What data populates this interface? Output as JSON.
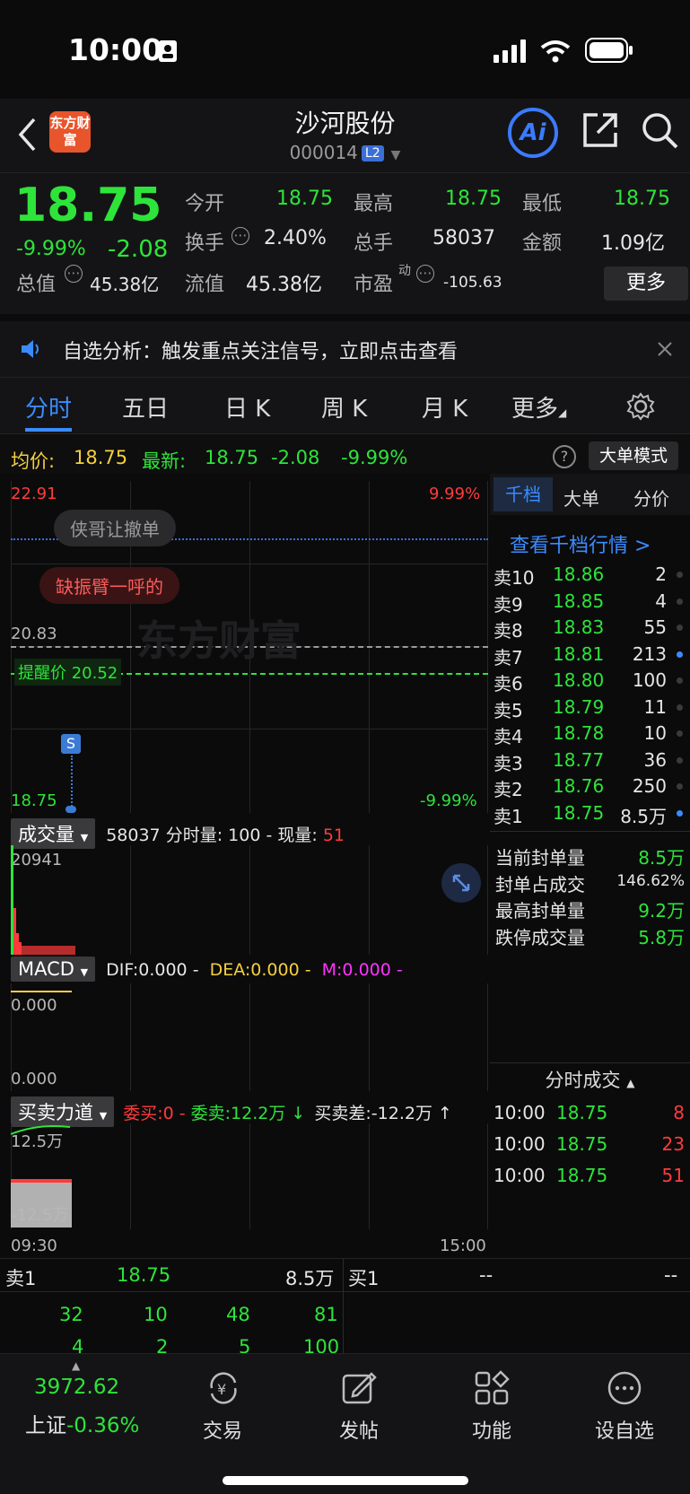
{
  "status_bar": {
    "time": "10:00"
  },
  "header": {
    "back_label": "‹",
    "logo_text": "东方财富",
    "title": "沙河股份",
    "code": "000014",
    "level_badge": "L2",
    "ai_label": "Ai"
  },
  "quote": {
    "price": "18.75",
    "change_pct": "-9.99%",
    "change": "-2.08",
    "open_label": "今开",
    "open": "18.75",
    "high_label": "最高",
    "high": "18.75",
    "low_label": "最低",
    "low": "18.75",
    "turnover_label": "换手",
    "turnover": "2.40%",
    "volume_label": "总手",
    "volume": "58037",
    "amount_label": "金额",
    "amount": "1.09亿",
    "total_cap_label": "总值",
    "total_cap": "45.38亿",
    "float_cap_label": "流值",
    "float_cap": "45.38亿",
    "pe_label": "市盈",
    "pe_sup": "动",
    "pe": "-105.63",
    "more_label": "更多"
  },
  "notice": {
    "text": "自选分析：触发重点关注信号，立即点击查看"
  },
  "tabs": [
    "分时",
    "五日",
    "日 K",
    "周 K",
    "月 K",
    "更多"
  ],
  "avg_bar": {
    "avg_label": "均价:",
    "avg": "18.75",
    "latest_label": "最新:",
    "latest": "18.75",
    "latest_change": "-2.08",
    "latest_pct": "-9.99%",
    "help": "?",
    "mode_button": "大单模式"
  },
  "chart": {
    "y_top_left": "22.91",
    "y_top_right": "9.99%",
    "y_mid_left": "20.83",
    "alert_label": "提醒价 20.52",
    "y_bottom_left": "18.75",
    "y_bottom_right": "-9.99%",
    "marker": "S",
    "bubble1": "侠哥让撤单",
    "bubble2": "缺振臂一呼的",
    "watermark": "东方财富"
  },
  "volume_panel": {
    "label": "成交量",
    "total": "58037",
    "per_min_label": "分时量:",
    "per_min": "100",
    "current_label": "现量:",
    "current": "51",
    "y_max": "20941"
  },
  "macd_panel": {
    "label": "MACD",
    "dif": "DIF:0.000",
    "dea": "DEA:0.000",
    "m": "M:0.000",
    "y_top": "0.000",
    "y_bottom": "0.000"
  },
  "force_panel": {
    "label": "买卖力道",
    "buy": "委买:0",
    "sell": "委卖:12.2万",
    "diff": "买卖差:-12.2万",
    "y_top": "12.5万",
    "y_bottom": "-12.5万",
    "x_start": "09:30",
    "x_end": "15:00"
  },
  "right_panel": {
    "tabs": [
      "千档",
      "大单",
      "分价"
    ],
    "link": "查看千档行情 >",
    "order_book": [
      {
        "label": "卖10",
        "price": "18.86",
        "vol": "2"
      },
      {
        "label": "卖9",
        "price": "18.85",
        "vol": "4"
      },
      {
        "label": "卖8",
        "price": "18.83",
        "vol": "55"
      },
      {
        "label": "卖7",
        "price": "18.81",
        "vol": "213"
      },
      {
        "label": "卖6",
        "price": "18.80",
        "vol": "100"
      },
      {
        "label": "卖5",
        "price": "18.79",
        "vol": "11"
      },
      {
        "label": "卖4",
        "price": "18.78",
        "vol": "10"
      },
      {
        "label": "卖3",
        "price": "18.77",
        "vol": "36"
      },
      {
        "label": "卖2",
        "price": "18.76",
        "vol": "250"
      },
      {
        "label": "卖1",
        "price": "18.75",
        "vol": "8.5万"
      }
    ],
    "stats": [
      {
        "label": "当前封单量",
        "value": "8.5万"
      },
      {
        "label": "封单占成交",
        "value": "146.62%"
      },
      {
        "label": "最高封单量",
        "value": "9.2万"
      },
      {
        "label": "跌停成交量",
        "value": "5.8万"
      }
    ],
    "trades_title": "分时成交",
    "trades": [
      {
        "time": "10:00",
        "price": "18.75",
        "vol": "8"
      },
      {
        "time": "10:00",
        "price": "18.75",
        "vol": "23"
      },
      {
        "time": "10:00",
        "price": "18.75",
        "vol": "51"
      }
    ]
  },
  "bottom_quote": {
    "sell1_label": "卖1",
    "sell1_price": "18.75",
    "sell1_vol": "8.5万",
    "buy1_label": "买1",
    "buy1_price": "--",
    "buy1_vol": "--",
    "row1": [
      "32",
      "10",
      "48",
      "81"
    ],
    "row2": [
      "4",
      "2",
      "5",
      "100"
    ]
  },
  "tab_bar": {
    "index_value": "3972.62",
    "index_name": "上证",
    "index_change": "-0.36%",
    "items": [
      "交易",
      "发帖",
      "功能",
      "设自选"
    ]
  },
  "colors": {
    "up": "#ff3b3b",
    "down": "#2ee43a",
    "accent": "#3b8bff",
    "avg": "#f4d03f"
  }
}
